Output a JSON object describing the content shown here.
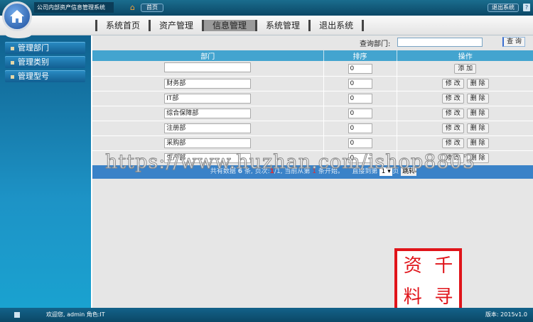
{
  "header": {
    "app_title": "公司内部资产信息管理系统",
    "home_label": "首页",
    "logout_label": "退出系统"
  },
  "nav": {
    "items": [
      {
        "label": "系统首页"
      },
      {
        "label": "资产管理"
      },
      {
        "label": "信息管理",
        "active": true
      },
      {
        "label": "系统管理"
      },
      {
        "label": "退出系统"
      }
    ]
  },
  "sidebar": {
    "items": [
      {
        "label": "管理部门"
      },
      {
        "label": "管理类别"
      },
      {
        "label": "管理型号"
      }
    ]
  },
  "search": {
    "label": "查询部门:",
    "value": "",
    "button": "查 询"
  },
  "table": {
    "headers": [
      "部门",
      "排序",
      "操作"
    ],
    "new_row": {
      "name": "",
      "order": "0",
      "add_label": "添 加"
    },
    "rows": [
      {
        "name": "财务部",
        "order": "0"
      },
      {
        "name": "IT部",
        "order": "0"
      },
      {
        "name": "综合保障部",
        "order": "0"
      },
      {
        "name": "注册部",
        "order": "0"
      },
      {
        "name": "采购部",
        "order": "0"
      },
      {
        "name": "生产部",
        "order": "0"
      }
    ],
    "edit_label": "修 改",
    "delete_label": "删 除"
  },
  "pager": {
    "p1": "共有数据",
    "total": "6",
    "p2": "条, 页次:",
    "page": "1",
    "p3": "/1, 当前从第",
    "start": "1",
    "p4": "条开始。",
    "p5": "直接到第",
    "select": "1 ▾",
    "p6": "页",
    "go": "跳转"
  },
  "watermark": "https://www.huzhan.com/ishop8803",
  "stamp": [
    "千",
    "资",
    "寻",
    "料"
  ],
  "footer": {
    "welcome": "欢迎您, admin 角色:IT",
    "version": "版本: 2015v1.0"
  }
}
